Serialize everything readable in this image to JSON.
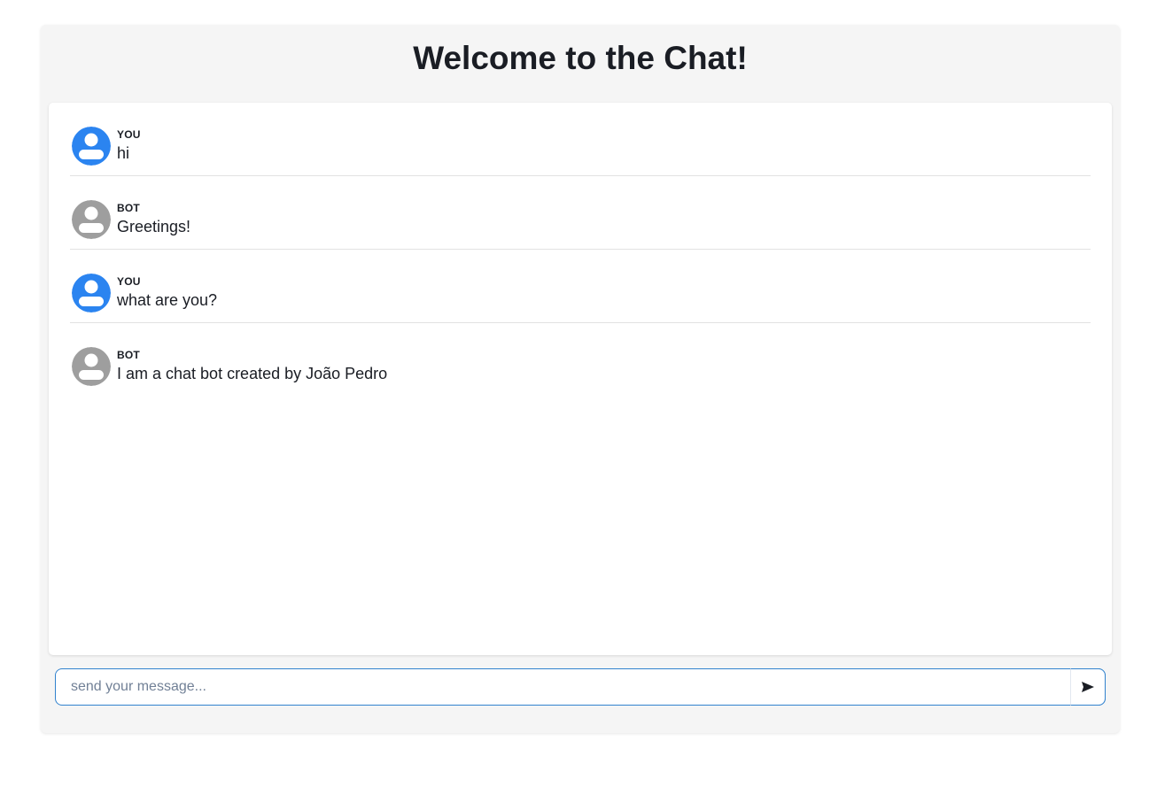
{
  "header": {
    "title": "Welcome to the Chat!"
  },
  "colors": {
    "user_avatar": "#2b84f0",
    "bot_avatar": "#9e9e9e",
    "input_border": "#3182ce"
  },
  "messages": [
    {
      "sender": "YOU",
      "text": "hi",
      "avatar_icon": "user-avatar-icon"
    },
    {
      "sender": "BOT",
      "text": "Greetings!",
      "avatar_icon": "bot-avatar-icon"
    },
    {
      "sender": "YOU",
      "text": "what are you?",
      "avatar_icon": "user-avatar-icon"
    },
    {
      "sender": "BOT",
      "text": "I am a chat bot created by João Pedro",
      "avatar_icon": "bot-avatar-icon"
    }
  ],
  "composer": {
    "placeholder": "send your message...",
    "value": "",
    "send_icon": "send-icon"
  }
}
